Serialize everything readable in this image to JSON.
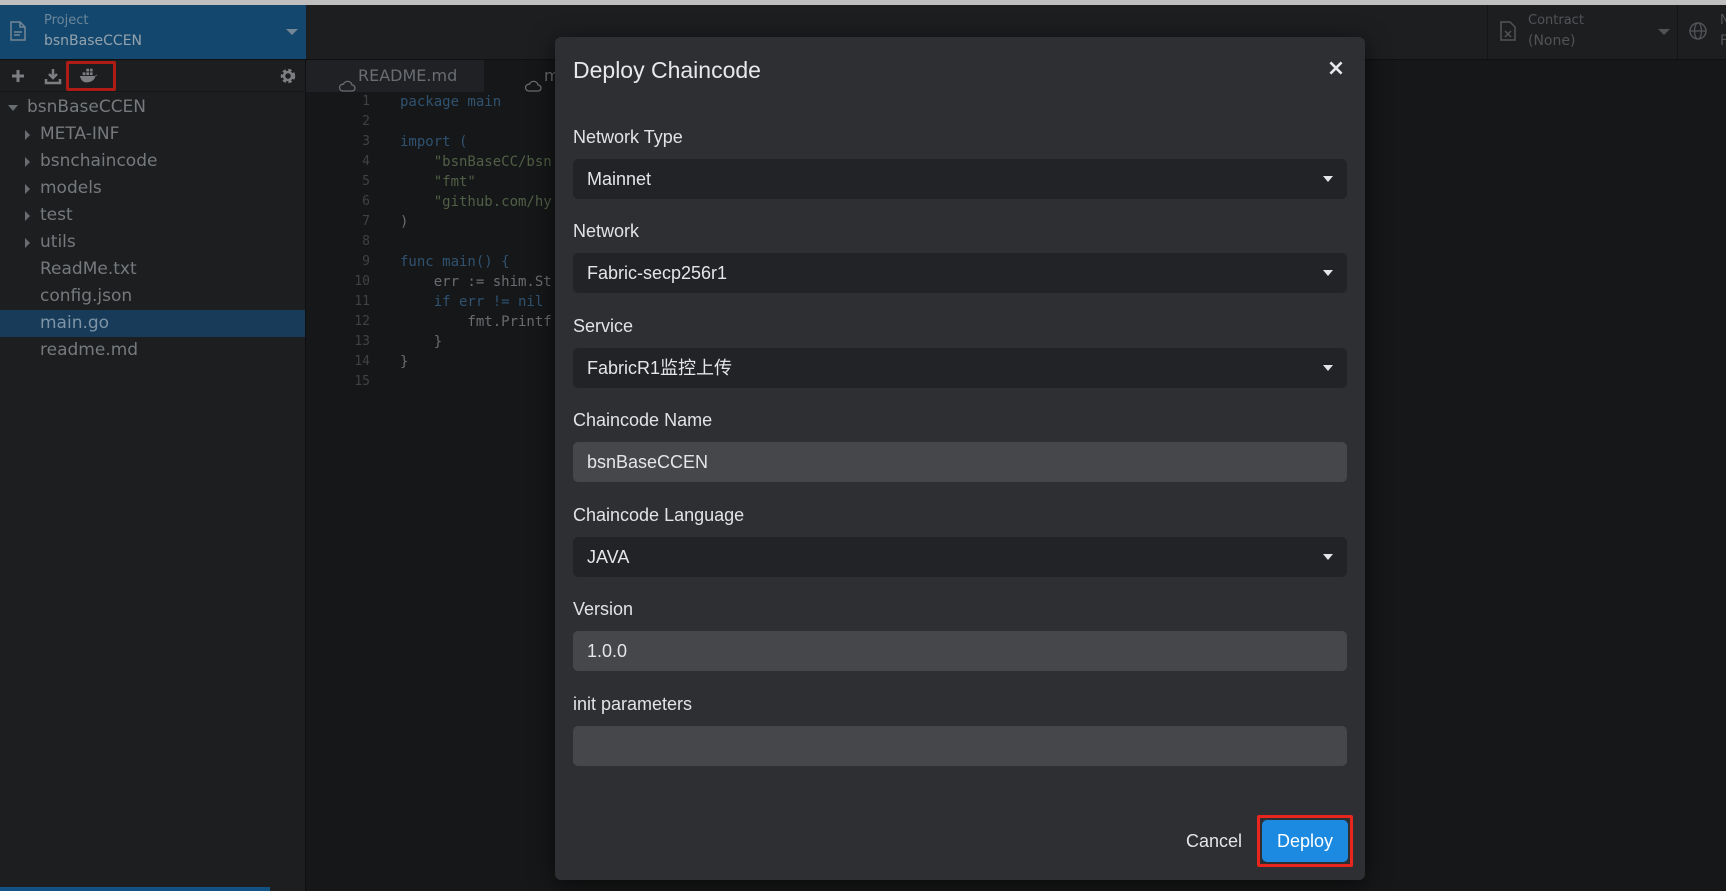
{
  "topbar": {
    "project_label": "Project",
    "project_value": "bsnBaseCCEN",
    "contract_label": "Contract",
    "contract_value": "(None)",
    "network_label": "N",
    "network_value": "F"
  },
  "sidebar": {
    "tools": [
      "add-icon",
      "download-icon",
      "docker-icon",
      "settings-icon"
    ],
    "tree": [
      {
        "label": "bsnBaseCCEN",
        "type": "folder-open",
        "level": 0
      },
      {
        "label": "META-INF",
        "type": "folder",
        "level": 1
      },
      {
        "label": "bsnchaincode",
        "type": "folder",
        "level": 1
      },
      {
        "label": "models",
        "type": "folder",
        "level": 1
      },
      {
        "label": "test",
        "type": "folder",
        "level": 1
      },
      {
        "label": "utils",
        "type": "folder",
        "level": 1
      },
      {
        "label": "ReadMe.txt",
        "type": "file",
        "level": 1
      },
      {
        "label": "config.json",
        "type": "file",
        "level": 1
      },
      {
        "label": "main.go",
        "type": "file",
        "level": 1,
        "active": true
      },
      {
        "label": "readme.md",
        "type": "file",
        "level": 1
      }
    ]
  },
  "tabs": [
    {
      "label": "README.md"
    },
    {
      "label": "ma"
    }
  ],
  "editor": {
    "lines": [
      {
        "n": "1",
        "code": "package main"
      },
      {
        "n": "2",
        "code": ""
      },
      {
        "n": "3",
        "code": "import ("
      },
      {
        "n": "4",
        "code": "    \"bsnBaseCC/bsn"
      },
      {
        "n": "5",
        "code": "    \"fmt\""
      },
      {
        "n": "6",
        "code": "    \"github.com/hy"
      },
      {
        "n": "7",
        "code": ")"
      },
      {
        "n": "8",
        "code": ""
      },
      {
        "n": "9",
        "code": "func main() {"
      },
      {
        "n": "10",
        "code": "    err := shim.St"
      },
      {
        "n": "11",
        "code": "    if err != nil"
      },
      {
        "n": "12",
        "code": "        fmt.Printf"
      },
      {
        "n": "13",
        "code": "    }"
      },
      {
        "n": "14",
        "code": "}"
      },
      {
        "n": "15",
        "code": ""
      }
    ]
  },
  "modal": {
    "title": "Deploy Chaincode",
    "close_glyph": "×",
    "network_type": {
      "label": "Network Type",
      "value": "Mainnet"
    },
    "network": {
      "label": "Network",
      "value": "Fabric-secp256r1"
    },
    "service": {
      "label": "Service",
      "value": "FabricR1监控上传"
    },
    "chaincode_name": {
      "label": "Chaincode Name",
      "value": "bsnBaseCCEN"
    },
    "chaincode_language": {
      "label": "Chaincode Language",
      "value": "JAVA"
    },
    "version": {
      "label": "Version",
      "value": "1.0.0"
    },
    "init_parameters": {
      "label": "init parameters",
      "value": ""
    },
    "cancel_label": "Cancel",
    "deploy_label": "Deploy"
  },
  "colors": {
    "accent": "#1b8ae0",
    "project_bar": "#1a5f92",
    "highlight": "#e8261d"
  }
}
